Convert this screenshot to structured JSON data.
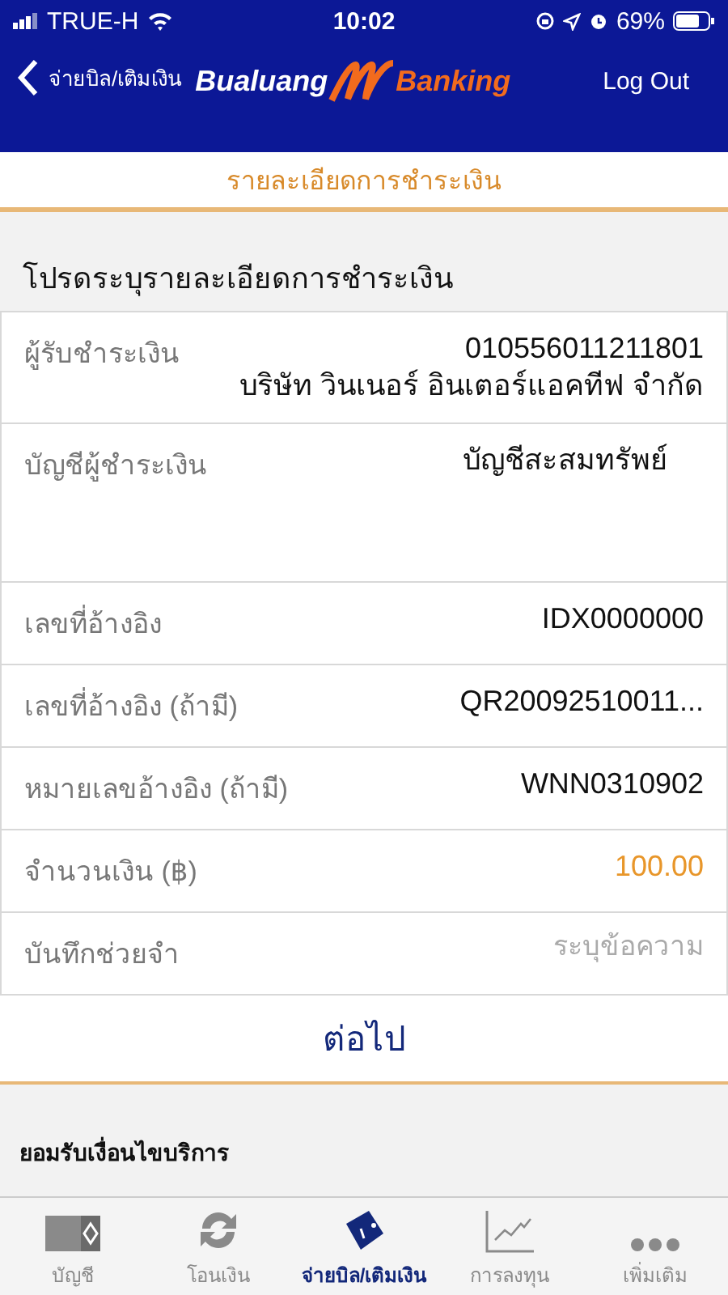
{
  "status_bar": {
    "carrier": "TRUE-H",
    "time": "10:02",
    "battery": "69%"
  },
  "header": {
    "back_label": "จ่ายบิล/เติมเงิน",
    "logo_left": "Bualuang",
    "logo_right": "Banking",
    "logout": "Log Out"
  },
  "section_title": "รายละเอียดการชำระเงิน",
  "instruction": "โปรดระบุรายละเอียดการชำระเงิน",
  "rows": [
    {
      "kind": "text",
      "label": "ผู้รับชำระเงิน",
      "value": "010556011211801",
      "value_2": "บริษัท วินเนอร์ อินเตอร์แอคทีฟ จำกัด"
    },
    {
      "kind": "tall",
      "label": "บัญชีผู้ชำระเงิน",
      "value": "บัญชีสะสมทรัพย์"
    },
    {
      "kind": "text",
      "label": "เลขที่อ้างอิง",
      "value": "IDX0000000"
    },
    {
      "kind": "text",
      "label": "เลขที่อ้างอิง (ถ้ามี)",
      "value": "QR20092510011..."
    },
    {
      "kind": "text",
      "label": "หมายเลขอ้างอิง (ถ้ามี)",
      "value": "WNN0310902"
    },
    {
      "kind": "amount",
      "label": "จำนวนเงิน (฿)",
      "value": "100.00"
    },
    {
      "kind": "input",
      "label": "บันทึกช่วยจำ",
      "placeholder": "ระบุข้อความ"
    }
  ],
  "next_button": "ต่อไป",
  "terms": "ยอมรับเงื่อนไขบริการ",
  "tabs": [
    {
      "kind": "account",
      "label": "บัญชี",
      "selected": false
    },
    {
      "kind": "transfer",
      "label": "โอนเงิน",
      "selected": false
    },
    {
      "kind": "pay",
      "label": "จ่ายบิล/เติมเงิน",
      "selected": true
    },
    {
      "kind": "invest",
      "label": "การลงทุน",
      "selected": false
    },
    {
      "kind": "more",
      "label": "เพิ่มเติม",
      "selected": false
    }
  ]
}
